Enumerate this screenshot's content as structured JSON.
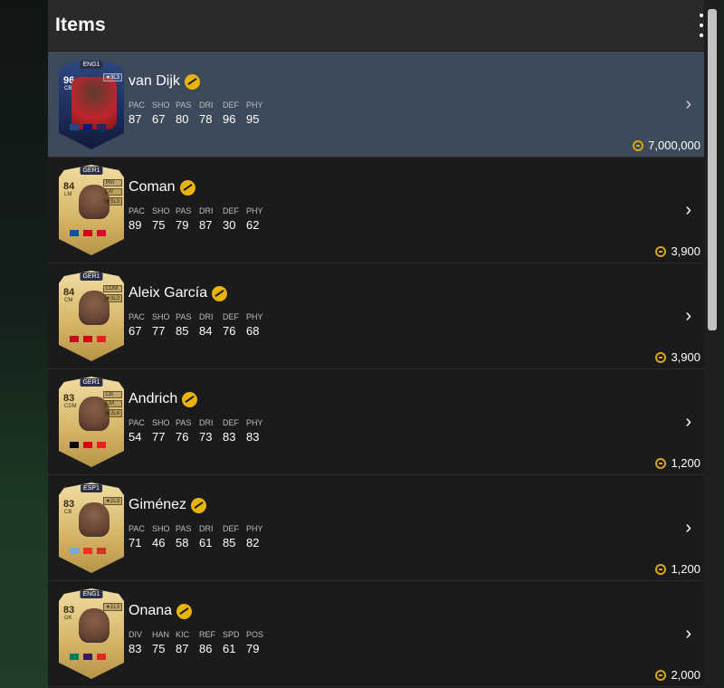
{
  "window": {
    "title": "Items"
  },
  "items": [
    {
      "name": "van Dijk",
      "rating": "96",
      "position": "CB",
      "league": "ENG1",
      "tags": [
        "★3L3"
      ],
      "stats_labels": [
        "PAC",
        "SHO",
        "PAS",
        "DRI",
        "DEF",
        "PHY"
      ],
      "stats": [
        "87",
        "67",
        "80",
        "78",
        "96",
        "95"
      ],
      "price": "7,000,000",
      "flags": [
        "#21468b",
        "#0b1a7a",
        "#1a2a5a"
      ]
    },
    {
      "name": "Coman",
      "rating": "84",
      "position": "LM",
      "league": "GER1",
      "tags": [
        "RM",
        "LW",
        "★5L3"
      ],
      "stats_labels": [
        "PAC",
        "SHO",
        "PAS",
        "DRI",
        "DEF",
        "PHY"
      ],
      "stats": [
        "89",
        "75",
        "79",
        "87",
        "30",
        "62"
      ],
      "price": "3,900",
      "flags": [
        "#0055a4",
        "#d20515",
        "#dc052d"
      ]
    },
    {
      "name": "Aleix García",
      "rating": "84",
      "position": "CM",
      "league": "GER1",
      "tags": [
        "CDM",
        "★3L3"
      ],
      "stats_labels": [
        "PAC",
        "SHO",
        "PAS",
        "DRI",
        "DEF",
        "PHY"
      ],
      "stats": [
        "67",
        "77",
        "85",
        "84",
        "76",
        "68"
      ],
      "price": "3,900",
      "flags": [
        "#c60b1e",
        "#d20515",
        "#e32221"
      ]
    },
    {
      "name": "Andrich",
      "rating": "83",
      "position": "CDM",
      "league": "GER1",
      "tags": [
        "CB",
        "CM",
        "★2L4"
      ],
      "stats_labels": [
        "PAC",
        "SHO",
        "PAS",
        "DRI",
        "DEF",
        "PHY"
      ],
      "stats": [
        "54",
        "77",
        "76",
        "73",
        "83",
        "83"
      ],
      "price": "1,200",
      "flags": [
        "#000000",
        "#d20515",
        "#e32221"
      ]
    },
    {
      "name": "Giménez",
      "rating": "83",
      "position": "CB",
      "league": "ESP1",
      "tags": [
        "★2L3"
      ],
      "stats_labels": [
        "PAC",
        "SHO",
        "PAS",
        "DRI",
        "DEF",
        "PHY"
      ],
      "stats": [
        "71",
        "46",
        "58",
        "61",
        "85",
        "82"
      ],
      "price": "1,200",
      "flags": [
        "#75aadb",
        "#ee3124",
        "#cb3524"
      ]
    },
    {
      "name": "Onana",
      "rating": "83",
      "position": "GK",
      "league": "ENG1",
      "tags": [
        "★1L3"
      ],
      "stats_labels": [
        "DIV",
        "HAN",
        "KIC",
        "REF",
        "SPD",
        "POS"
      ],
      "stats": [
        "83",
        "75",
        "87",
        "86",
        "61",
        "79"
      ],
      "price": "2,000",
      "flags": [
        "#007a5e",
        "#3d195b",
        "#da291c"
      ]
    }
  ]
}
